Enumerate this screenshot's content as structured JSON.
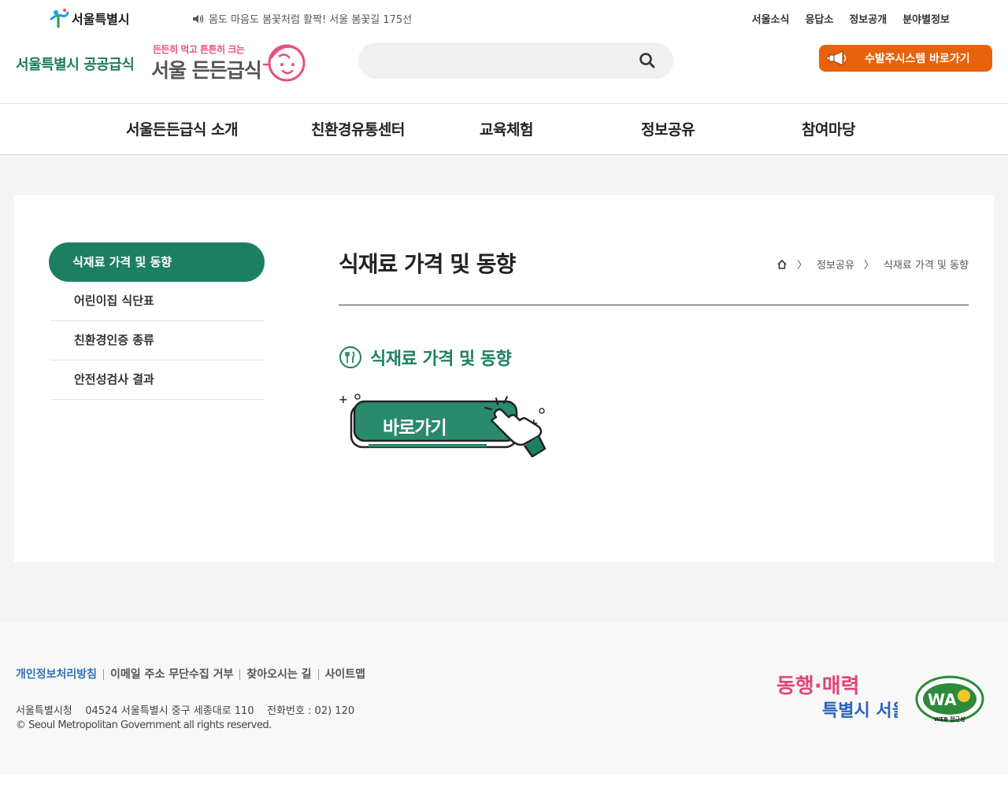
{
  "header": {
    "seoul_logo_text": "서울특별시",
    "notice_text": "몸도 마음도 봄꽃처럼 활짝! 서울 봄꽃길 175선",
    "util_links": [
      "서울소식",
      "응답소",
      "정보공개",
      "분야별정보"
    ],
    "site_title": "서울특별시 공공급식",
    "brand_tagline": "든든히 먹고 튼튼히 크는",
    "brand_name": "서울 든든급식",
    "search_placeholder": "",
    "order_button_label": "수발주시스템 바로가기"
  },
  "gnb": {
    "items": [
      "서울든든급식 소개",
      "친환경유통센터",
      "교육체험",
      "정보공유",
      "참여마당"
    ]
  },
  "lnb": {
    "active": "식재료 가격 및 동향",
    "items": [
      "어린이집 식단표",
      "친환경인증 종류",
      "안전성검사 결과"
    ]
  },
  "content": {
    "page_title": "식재료 가격 및 동향",
    "breadcrumb": [
      "정보공유",
      "식재료 가격 및 동향"
    ],
    "section_title": "식재료 가격 및 동향",
    "shortcut_label": "바로가기"
  },
  "footer": {
    "links": [
      "개인정보처리방침",
      "이메일 주소 무단수집 거부",
      "찾아오시는 길",
      "사이트맵"
    ],
    "address": "서울특별시청    04524 서울특별시 중구 세종대로 110    전화번호 : 02) 120",
    "copyright": "© Seoul Metropolitan Government all rights reserved.",
    "slogan_line1": "동행·매력",
    "slogan_line2": "특별시 서울",
    "wa_text": "WA",
    "wa_caption": "WEB 접근성"
  },
  "colors": {
    "brand_green": "#1d7f62",
    "title_green": "#1c7e55",
    "order_orange": "#e8620b",
    "tagline_pink": "#e6527a",
    "footer_link_blue": "#2f6fb5"
  },
  "icons": [
    "seoul-emblem-icon",
    "speaker-icon",
    "search-icon",
    "megaphone-icon",
    "home-icon",
    "spoon-fork-icon",
    "pointing-hand-icon"
  ]
}
